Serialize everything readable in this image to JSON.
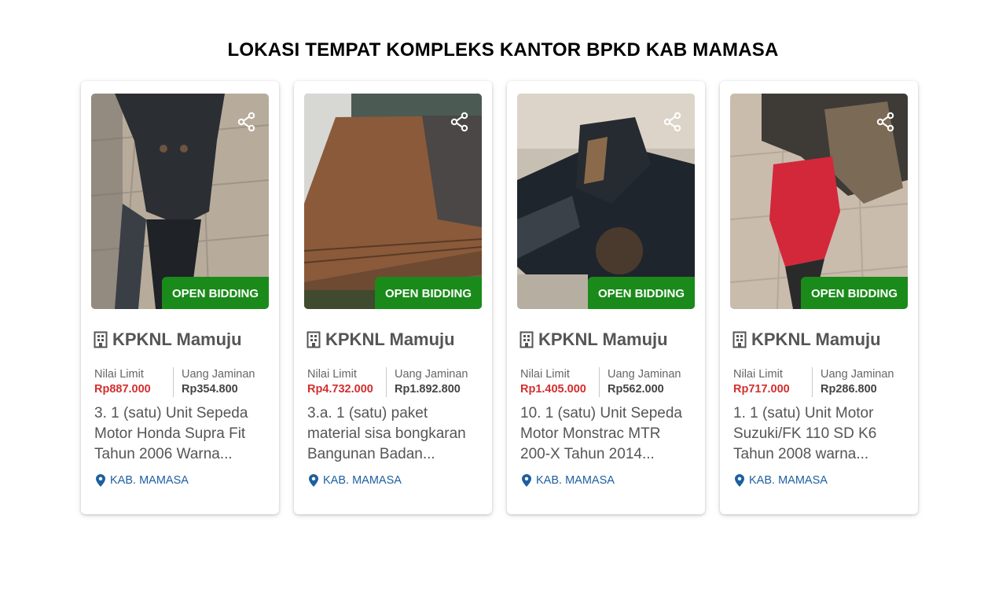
{
  "page": {
    "title": "LOKASI TEMPAT KOMPLEKS KANTOR BPKD KAB MAMASA"
  },
  "colors": {
    "badge": "#1a8a1a",
    "limit_price": "#d32f2f",
    "location": "#1e5fa0"
  },
  "cards": [
    {
      "image_icon": "motorcycle-front-photo",
      "badge": "OPEN BIDDING",
      "organization": "KPKNL Mamuju",
      "limit_label": "Nilai Limit",
      "limit_value": "Rp887.000",
      "deposit_label": "Uang Jaminan",
      "deposit_value": "Rp354.800",
      "title_lines": [
        "3. 1 (satu) Unit Sepeda",
        "Motor Honda Supra Fit",
        "Tahun 2006 Warna..."
      ],
      "location": "KAB. MAMASA"
    },
    {
      "image_icon": "rusty-metal-sheets-photo",
      "badge": "OPEN BIDDING",
      "organization": "KPKNL Mamuju",
      "limit_label": "Nilai Limit",
      "limit_value": "Rp4.732.000",
      "deposit_label": "Uang Jaminan",
      "deposit_value": "Rp1.892.800",
      "title_lines": [
        "3.a. 1 (satu) paket",
        "material sisa bongkaran",
        "Bangunan Badan..."
      ],
      "location": "KAB. MAMASA"
    },
    {
      "image_icon": "motorcycle-frame-photo",
      "badge": "OPEN BIDDING",
      "organization": "KPKNL Mamuju",
      "limit_label": "Nilai Limit",
      "limit_value": "Rp1.405.000",
      "deposit_label": "Uang Jaminan",
      "deposit_value": "Rp562.000",
      "title_lines": [
        "10. 1 (satu) Unit Sepeda",
        "Motor Monstrac MTR",
        "200-X Tahun 2014..."
      ],
      "location": "KAB. MAMASA"
    },
    {
      "image_icon": "red-motorcycle-photo",
      "badge": "OPEN BIDDING",
      "organization": "KPKNL Mamuju",
      "limit_label": "Nilai Limit",
      "limit_value": "Rp717.000",
      "deposit_label": "Uang Jaminan",
      "deposit_value": "Rp286.800",
      "title_lines": [
        "1. 1 (satu) Unit Motor",
        "Suzuki/FK 110 SD K6",
        "Tahun 2008 warna..."
      ],
      "location": "KAB. MAMASA"
    }
  ]
}
